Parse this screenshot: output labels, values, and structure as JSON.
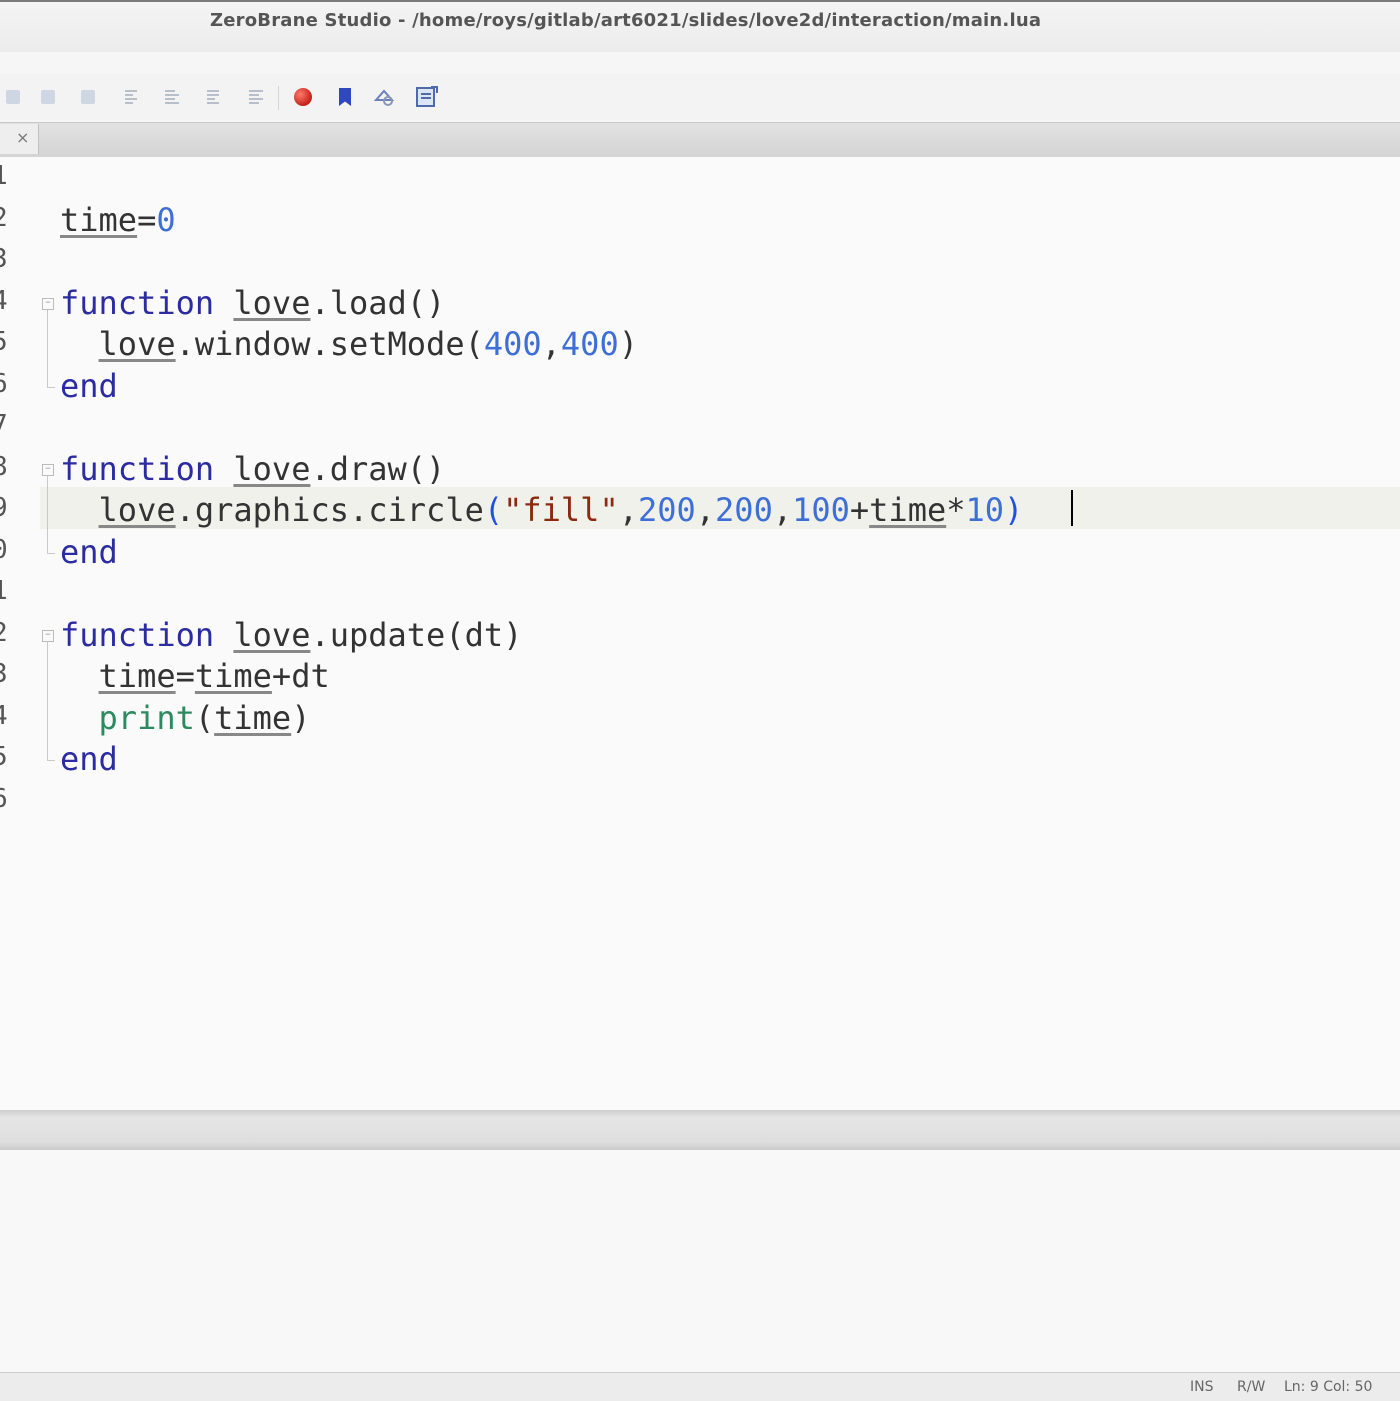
{
  "window": {
    "title": "ZeroBrane Studio - /home/roys/gitlab/art6021/slides/love2d/interaction/main.lua"
  },
  "toolbar": {
    "icons": [
      "indent-icon",
      "outdent-icon",
      "comment-icon",
      "align-left-icon",
      "align-center-icon",
      "align-right-icon",
      "align-justify-icon",
      "breakpoint-icon",
      "bookmark-icon",
      "find-replace-icon",
      "find-in-files-icon"
    ],
    "accent": {
      "breakpoint": "#c4211a",
      "bookmark": "#2f48c0"
    }
  },
  "tabs": [
    {
      "close_label": "×"
    }
  ],
  "editor": {
    "line_numbers": [
      "1",
      "2",
      "3",
      "4",
      "5",
      "6",
      "7",
      "8",
      "9",
      "0",
      "1",
      "2",
      "3",
      "4",
      "5",
      "6"
    ],
    "lines": [
      {
        "tokens": []
      },
      {
        "tokens": [
          {
            "t": "time",
            "c": "lib"
          },
          {
            "t": "=",
            "c": ""
          },
          {
            "t": "0",
            "c": "num"
          }
        ]
      },
      {
        "tokens": []
      },
      {
        "tokens": [
          {
            "t": "function",
            "c": "kw"
          },
          {
            "t": " ",
            "c": ""
          },
          {
            "t": "love",
            "c": "lib"
          },
          {
            "t": ".load()",
            "c": ""
          }
        ]
      },
      {
        "tokens": [
          {
            "t": "  ",
            "c": ""
          },
          {
            "t": "love",
            "c": "lib"
          },
          {
            "t": ".window.setMode(",
            "c": ""
          },
          {
            "t": "400",
            "c": "num"
          },
          {
            "t": ",",
            "c": ""
          },
          {
            "t": "400",
            "c": "num"
          },
          {
            "t": ")",
            "c": ""
          }
        ]
      },
      {
        "tokens": [
          {
            "t": "end",
            "c": "kw"
          }
        ]
      },
      {
        "tokens": []
      },
      {
        "tokens": [
          {
            "t": "function",
            "c": "kw"
          },
          {
            "t": " ",
            "c": ""
          },
          {
            "t": "love",
            "c": "lib"
          },
          {
            "t": ".draw()",
            "c": ""
          }
        ]
      },
      {
        "tokens": [
          {
            "t": "  ",
            "c": ""
          },
          {
            "t": "love",
            "c": "lib"
          },
          {
            "t": ".graphics.circle",
            "c": ""
          },
          {
            "t": "(",
            "c": "par-hl"
          },
          {
            "t": "\"fill\"",
            "c": "str"
          },
          {
            "t": ",",
            "c": ""
          },
          {
            "t": "200",
            "c": "num"
          },
          {
            "t": ",",
            "c": ""
          },
          {
            "t": "200",
            "c": "num"
          },
          {
            "t": ",",
            "c": ""
          },
          {
            "t": "100",
            "c": "num"
          },
          {
            "t": "+",
            "c": ""
          },
          {
            "t": "time",
            "c": "lib"
          },
          {
            "t": "*",
            "c": ""
          },
          {
            "t": "10",
            "c": "num"
          },
          {
            "t": ")",
            "c": "par-hl"
          }
        ]
      },
      {
        "tokens": [
          {
            "t": "end",
            "c": "kw"
          }
        ]
      },
      {
        "tokens": []
      },
      {
        "tokens": [
          {
            "t": "function",
            "c": "kw"
          },
          {
            "t": " ",
            "c": ""
          },
          {
            "t": "love",
            "c": "lib"
          },
          {
            "t": ".update(dt)",
            "c": ""
          }
        ]
      },
      {
        "tokens": [
          {
            "t": "  ",
            "c": ""
          },
          {
            "t": "time",
            "c": "lib"
          },
          {
            "t": "=",
            "c": ""
          },
          {
            "t": "time",
            "c": "lib"
          },
          {
            "t": "+dt",
            "c": ""
          }
        ]
      },
      {
        "tokens": [
          {
            "t": "  ",
            "c": ""
          },
          {
            "t": "print",
            "c": "fn"
          },
          {
            "t": "(",
            "c": ""
          },
          {
            "t": "time",
            "c": "lib"
          },
          {
            "t": ")",
            "c": ""
          }
        ]
      },
      {
        "tokens": [
          {
            "t": "end",
            "c": "kw"
          }
        ]
      },
      {
        "tokens": []
      }
    ]
  },
  "statusbar": {
    "mode": "INS",
    "access": "R/W",
    "position": "Ln: 9 Col: 50"
  }
}
